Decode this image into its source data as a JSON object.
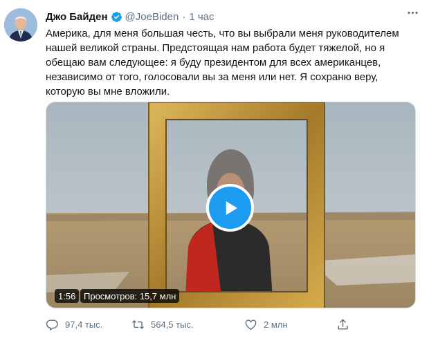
{
  "tweet": {
    "author_name": "Джо Байден",
    "handle": "@JoeBiden",
    "separator": "·",
    "time": "1 час",
    "text": "Америка, для меня большая честь, что вы выбрали меня руководителем нашей великой страны. Предстоящая нам работа будет тяжелой, но я обещаю вам следующее: я буду президентом для всех американцев, независимо от того, голосовали вы за меня или нет. Я сохраню веру, которую вы мне вложили.",
    "icons": {
      "verified": "verified-badge-icon",
      "more": "more-dots-icon"
    }
  },
  "video": {
    "duration": "1:56",
    "views": "Просмотров: 15,7 млн",
    "play_icon": "play-icon"
  },
  "actions": {
    "reply_count": "97,4 тыс.",
    "retweet_count": "564,5 тыс.",
    "like_count": "2 млн",
    "icons": [
      "reply-icon",
      "retweet-icon",
      "like-icon",
      "share-icon"
    ]
  },
  "colors": {
    "accent": "#1d9bf0",
    "secondary_text": "#5b7083",
    "primary_text": "#0f1419"
  }
}
